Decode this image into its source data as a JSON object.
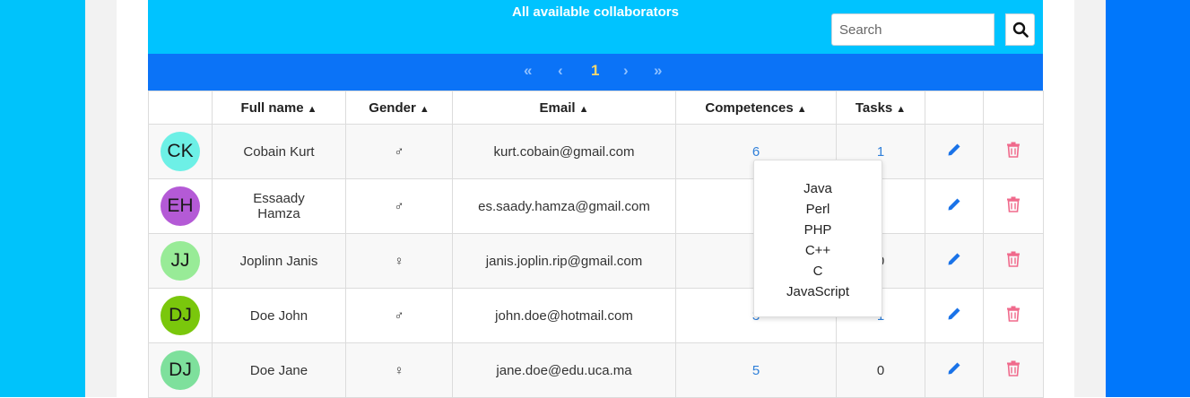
{
  "header": {
    "title": "All available collaborators",
    "search_placeholder": "Search"
  },
  "pagination": {
    "first": "«",
    "prev": "‹",
    "current": "1",
    "next": "›",
    "last": "»"
  },
  "table": {
    "columns": [
      "",
      "Full name",
      "Gender",
      "Email",
      "Competences",
      "Tasks",
      "",
      ""
    ],
    "rows": [
      {
        "initials": "CK",
        "avatar_color": "#6df0e6",
        "name": "Cobain Kurt",
        "gender": "♂",
        "email": "kurt.cobain@gmail.com",
        "competences": "6",
        "tasks": "1"
      },
      {
        "initials": "EH",
        "avatar_color": "#b45ad6",
        "name": "Essaady Hamza",
        "gender": "♂",
        "email": "es.saady.hamza@gmail.com",
        "competences": "",
        "tasks": ""
      },
      {
        "initials": "JJ",
        "avatar_color": "#98eb97",
        "name": "Joplinn Janis",
        "gender": "♀",
        "email": "janis.joplin.rip@gmail.com",
        "competences": "",
        "tasks": "0"
      },
      {
        "initials": "DJ",
        "avatar_color": "#7ac70c",
        "name": "Doe John",
        "gender": "♂",
        "email": "john.doe@hotmail.com",
        "competences": "3",
        "tasks": "1"
      },
      {
        "initials": "DJ",
        "avatar_color": "#7ee09c",
        "name": "Doe Jane",
        "gender": "♀",
        "email": "jane.doe@edu.uca.ma",
        "competences": "5",
        "tasks": "0"
      }
    ]
  },
  "popover": {
    "items": [
      "Java",
      "Perl",
      "PHP",
      "C++",
      "C",
      "JavaScript"
    ]
  },
  "colors": {
    "left_band": "#00c3fb",
    "right_band": "#0077fb",
    "header": "#00c3ff",
    "pager": "#0b73f7",
    "edit_icon": "#1a73e8",
    "delete_icon": "#f06a8c"
  },
  "icons": {
    "search": "search-icon",
    "sort": "sort-icon",
    "edit": "pencil-icon",
    "delete": "trash-icon"
  }
}
